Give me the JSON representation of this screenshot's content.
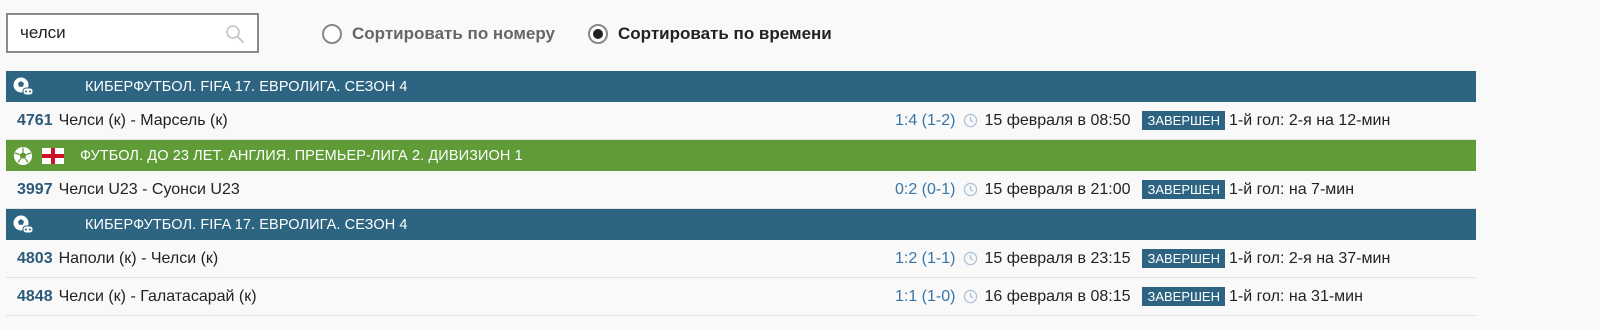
{
  "search": {
    "value": "челси",
    "icon": "search-icon"
  },
  "sort": {
    "by_number": {
      "label": "Сортировать по номеру",
      "checked": false
    },
    "by_time": {
      "label": "Сортировать по времени",
      "checked": true
    }
  },
  "colors": {
    "header_blue": "#2c6482",
    "header_green": "#5f9c38",
    "score": "#3a76a8",
    "badge": "#2c6482"
  },
  "groups": [
    {
      "title": "КИБЕРФУТБОЛ. FIFA 17. ЕВРОЛИГА. СЕЗОН 4",
      "icon": "cyberfootball-icon",
      "matches": [
        {
          "num": "4761",
          "teams": "Челси (к) - Марсель (к)",
          "score": "1:4 (1-2)",
          "date": "15 февраля в 08:50",
          "status": "ЗАВЕРШЕН",
          "first_goal": "1-й гол: 2-я на 12-мин"
        }
      ]
    },
    {
      "title": "ФУТБОЛ. ДО 23 ЛЕТ. АНГЛИЯ. ПРЕМЬЕР-ЛИГА 2. ДИВИЗИОН 1",
      "icon": "football-icon",
      "flag": "england-flag-icon",
      "matches": [
        {
          "num": "3997",
          "teams": "Челси U23 - Суонси U23",
          "score": "0:2 (0-1)",
          "date": "15 февраля в 21:00",
          "status": "ЗАВЕРШЕН",
          "first_goal": "1-й гол: на 7-мин"
        }
      ]
    },
    {
      "title": "КИБЕРФУТБОЛ. FIFA 17. ЕВРОЛИГА. СЕЗОН 4",
      "icon": "cyberfootball-icon",
      "matches": [
        {
          "num": "4803",
          "teams": "Наполи (к) - Челси (к)",
          "score": "1:2 (1-1)",
          "date": "15 февраля в 23:15",
          "status": "ЗАВЕРШЕН",
          "first_goal": "1-й гол: 2-я на 37-мин"
        },
        {
          "num": "4848",
          "teams": "Челси (к) - Галатасарай (к)",
          "score": "1:1 (1-0)",
          "date": "16 февраля в 08:15",
          "status": "ЗАВЕРШЕН",
          "first_goal": "1-й гол: на 31-мин"
        }
      ]
    }
  ]
}
